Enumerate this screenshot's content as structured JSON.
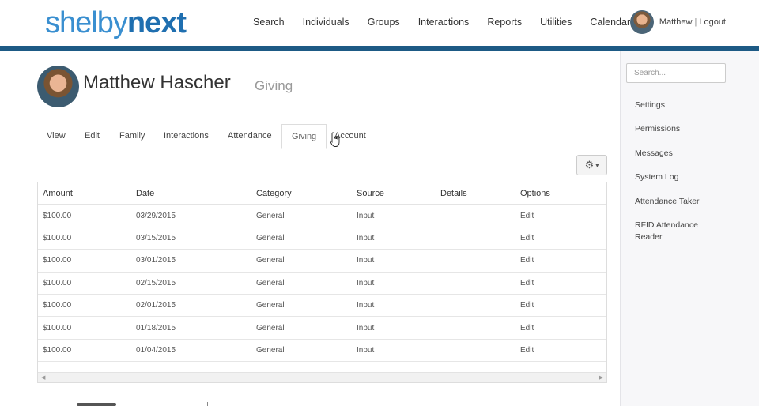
{
  "logo": {
    "part1": "shelby",
    "part2": "next"
  },
  "nav": [
    "Search",
    "Individuals",
    "Groups",
    "Interactions",
    "Reports",
    "Utilities",
    "Calendar"
  ],
  "user": {
    "name": "Matthew",
    "separator": "|",
    "logout": "Logout"
  },
  "person": {
    "name": "Matthew Hascher",
    "section": "Giving"
  },
  "tabs": [
    "View",
    "Edit",
    "Family",
    "Interactions",
    "Attendance",
    "Giving",
    "Account"
  ],
  "active_tab": "Giving",
  "table": {
    "headers": [
      "Amount",
      "Date",
      "Category",
      "Source",
      "Details",
      "Options"
    ],
    "rows": [
      [
        "$100.00",
        "03/29/2015",
        "General",
        "Input",
        "",
        "Edit"
      ],
      [
        "$100.00",
        "03/15/2015",
        "General",
        "Input",
        "",
        "Edit"
      ],
      [
        "$100.00",
        "03/01/2015",
        "General",
        "Input",
        "",
        "Edit"
      ],
      [
        "$100.00",
        "02/15/2015",
        "General",
        "Input",
        "",
        "Edit"
      ],
      [
        "$100.00",
        "02/01/2015",
        "General",
        "Input",
        "",
        "Edit"
      ],
      [
        "$100.00",
        "01/18/2015",
        "General",
        "Input",
        "",
        "Edit"
      ],
      [
        "$100.00",
        "01/04/2015",
        "General",
        "Input",
        "",
        "Edit"
      ]
    ]
  },
  "sidebar": {
    "search_placeholder": "Search...",
    "items": [
      "Settings",
      "Permissions",
      "Messages",
      "System Log",
      "Attendance Taker",
      "RFID Attendance Reader"
    ]
  },
  "colors": {
    "header_bar": "#1d5a85",
    "logo_light": "#3a8fd0",
    "logo_dark": "#1f6fb0"
  },
  "icons": {
    "gear": "gear-icon",
    "caret": "caret-down-icon"
  }
}
